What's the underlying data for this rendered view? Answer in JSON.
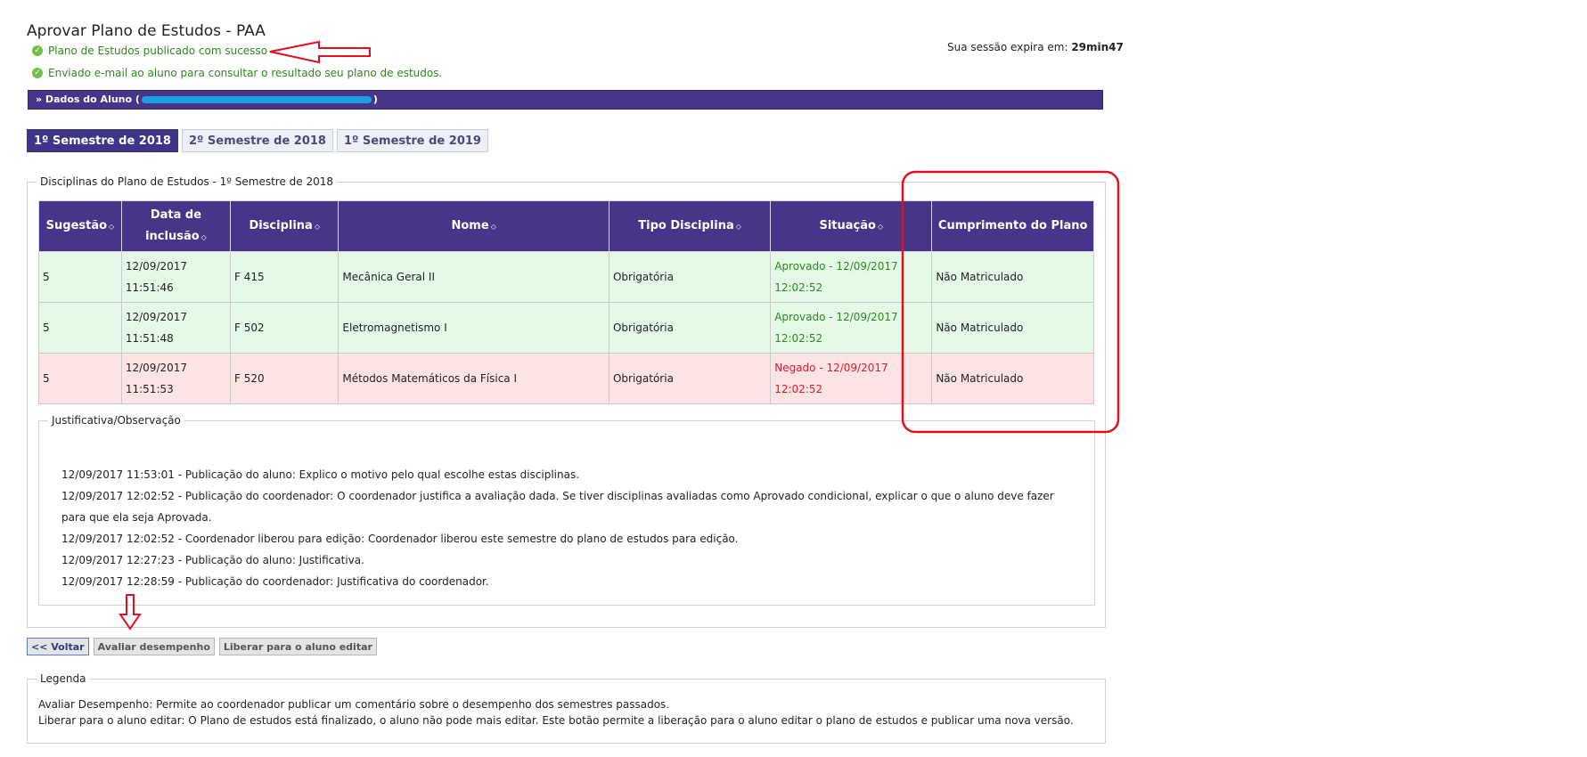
{
  "page": {
    "title": "Aprovar Plano de Estudos - PAA"
  },
  "session": {
    "label": "Sua sessão expira em:",
    "value": "29min47"
  },
  "messages": [
    "Plano de Estudos publicado com sucesso",
    "Enviado e-mail ao aluno para consultar o resultado seu plano de estudos."
  ],
  "student_bar": {
    "prefix": "» Dados do Aluno (",
    "suffix": ")"
  },
  "tabs": [
    {
      "label": "1º Semestre de 2018",
      "active": true
    },
    {
      "label": "2º Semestre de 2018",
      "active": false
    },
    {
      "label": "1º Semestre de 2019",
      "active": false
    }
  ],
  "disciplines": {
    "legend": "Disciplinas do Plano de Estudos - 1º Semestre de 2018",
    "headers": {
      "sugestao": "Sugestão",
      "data_line1": "Data de",
      "data_line2": "inclusão",
      "disciplina": "Disciplina",
      "nome": "Nome",
      "tipo": "Tipo Disciplina",
      "situacao": "Situação",
      "cumprimento": "Cumprimento do Plano"
    },
    "rows": [
      {
        "sugestao": "5",
        "data1": "12/09/2017",
        "data2": "11:51:46",
        "disciplina": "F 415",
        "nome": "Mecânica Geral II",
        "tipo": "Obrigatória",
        "sit1": "Aprovado - 12/09/2017",
        "sit2": "12:02:52",
        "cumprimento": "Não Matriculado"
      },
      {
        "sugestao": "5",
        "data1": "12/09/2017",
        "data2": "11:51:48",
        "disciplina": "F 502",
        "nome": "Eletromagnetismo I",
        "tipo": "Obrigatória",
        "sit1": "Aprovado - 12/09/2017",
        "sit2": "12:02:52",
        "cumprimento": "Não Matriculado"
      },
      {
        "sugestao": "5",
        "data1": "12/09/2017",
        "data2": "11:51:53",
        "disciplina": "F 520",
        "nome": "Métodos Matemáticos da Física I",
        "tipo": "Obrigatória",
        "sit1": "Negado - 12/09/2017",
        "sit2": "12:02:52",
        "cumprimento": "Não Matriculado"
      }
    ]
  },
  "justificativa": {
    "legend": "Justificativa/Observação",
    "lines": [
      "12/09/2017 11:53:01 - Publicação do aluno: Explico o motivo pelo qual escolhe estas disciplinas.",
      "12/09/2017 12:02:52 - Publicação do coordenador: O coordenador justifica a avaliação dada. Se tiver disciplinas avaliadas como Aprovado condicional, explicar o que o aluno deve fazer",
      "para que ela seja Aprovada.",
      "12/09/2017 12:02:52 - Coordenador liberou para edição: Coordenador liberou este semestre do plano de estudos para edição.",
      "12/09/2017 12:27:23 - Publicação do aluno: Justificativa.",
      "12/09/2017 12:28:59 - Publicação do coordenador: Justificativa do coordenador."
    ]
  },
  "buttons": {
    "voltar": "<< Voltar",
    "avaliar": "Avaliar desempenho",
    "liberar": "Liberar para o aluno editar"
  },
  "legenda": {
    "legend": "Legenda",
    "lines": [
      "Avaliar Desempenho: Permite ao coordenador publicar um comentário sobre o desempenho dos semestres passados.",
      "Liberar para o aluno editar: O Plano de estudos está finalizado, o aluno não pode mais editar. Este botão permite a liberação para o aluno editar o plano de estudos e publicar uma nova versão."
    ]
  },
  "colors": {
    "header_purple": "#47358a",
    "approved_bg": "#e4fae7",
    "denied_bg": "#fde4e4",
    "ok_green": "#2a8a1a",
    "denied_red": "#e0182a",
    "annotation_red": "#e0101e"
  }
}
